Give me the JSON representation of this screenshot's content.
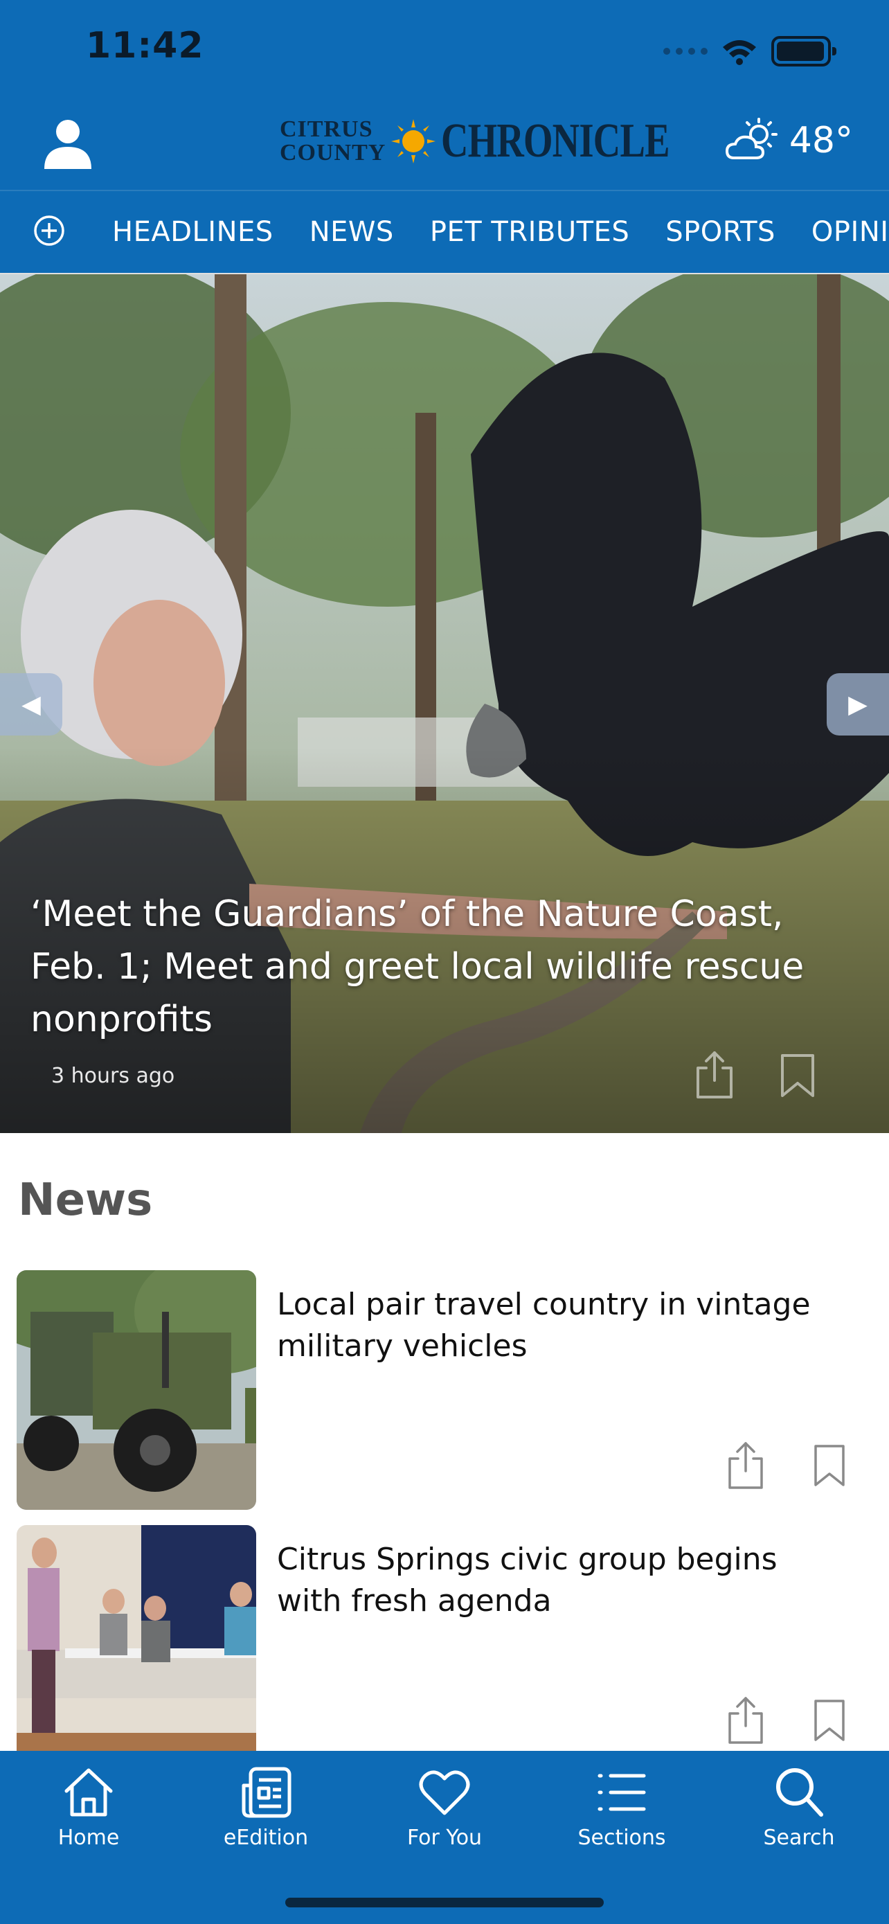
{
  "status": {
    "time": "11:42"
  },
  "header": {
    "logo_top": "Citrus",
    "logo_bottom": "County",
    "logo_main": "CHRONICLE",
    "weather_temp": "48°"
  },
  "nav": {
    "items": [
      "HEADLINES",
      "NEWS",
      "PET TRIBUTES",
      "SPORTS",
      "OPINION"
    ]
  },
  "hero": {
    "title": "‘Meet the Guardians’ of the Nature Coast, Feb. 1; Meet and greet local wildlife rescue nonprofits",
    "time": "3 hours ago"
  },
  "news": {
    "section_title": "News",
    "articles": [
      {
        "headline": "Local pair travel country in vintage military vehicles"
      },
      {
        "headline": "Citrus Springs civic group begins with fresh agenda"
      }
    ]
  },
  "tabbar": {
    "items": [
      {
        "label": "Home",
        "icon": "home-icon"
      },
      {
        "label": "eEdition",
        "icon": "newspaper-icon"
      },
      {
        "label": "For You",
        "icon": "heart-icon"
      },
      {
        "label": "Sections",
        "icon": "list-icon"
      },
      {
        "label": "Search",
        "icon": "search-icon"
      }
    ]
  },
  "colors": {
    "brand_blue": "#0d6bb6",
    "logo_navy": "#0b2740",
    "sun": "#f5a800"
  }
}
